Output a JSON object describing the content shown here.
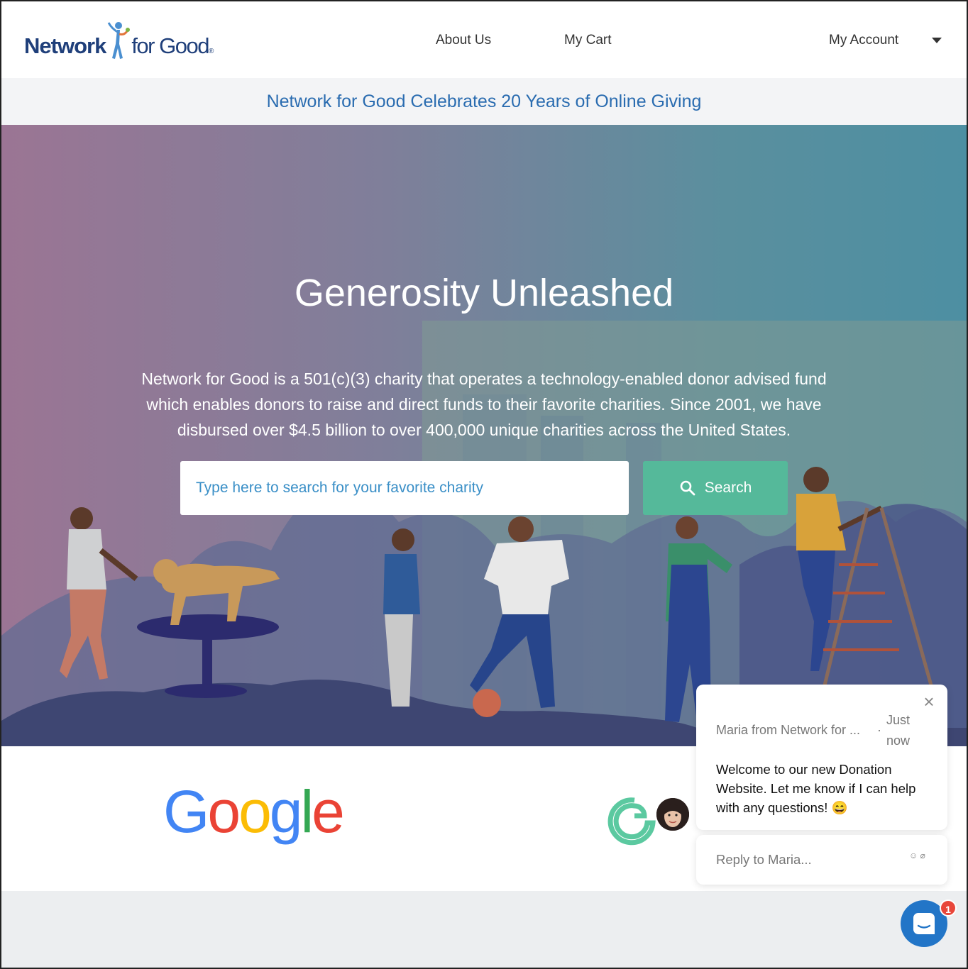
{
  "header": {
    "logo_part1": "Network",
    "logo_part2": "for Good",
    "nav": {
      "about": "About Us",
      "cart": "My Cart",
      "account": "My Account"
    }
  },
  "banner": {
    "text": "Network for Good Celebrates 20 Years of Online Giving"
  },
  "hero": {
    "title": "Generosity Unleashed",
    "description": "Network for Good is a 501(c)(3) charity that operates a technology-enabled donor advised fund which enables donors to raise and direct funds to their favorite charities. Since 2001, we have disbursed over $4.5 billion to over 400,000 unique charities across the United States.",
    "search_placeholder": "Type here to search for your favorite charity",
    "search_button": "Search"
  },
  "partners": {
    "google": "Google"
  },
  "chat": {
    "sender": "Maria from Network for ...",
    "separator": "·",
    "time": "Just now",
    "message": "Welcome to our new Donation Website. Let me know if I can help with any questions! 😄",
    "reply_placeholder": "Reply to Maria...",
    "unread_count": "1"
  },
  "colors": {
    "brand_navy": "#1f3f7a",
    "banner_link": "#2a6cb0",
    "search_button": "#55b99a",
    "chat_launcher": "#2275c7",
    "badge": "#e8463a"
  }
}
